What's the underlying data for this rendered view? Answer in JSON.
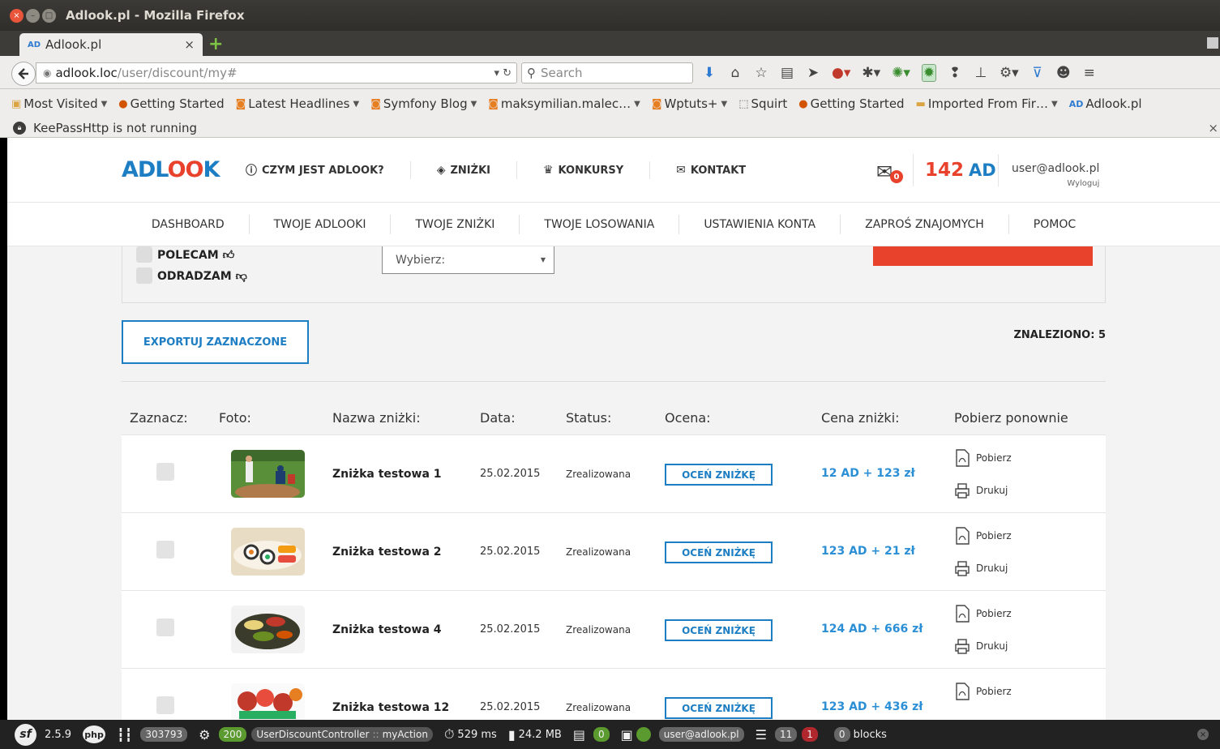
{
  "window": {
    "title": "Adlook.pl - Mozilla Firefox"
  },
  "tab": {
    "favicon": "AD",
    "title": "Adlook.pl",
    "close": "×",
    "new_tab": "+"
  },
  "navbar": {
    "url_host": "adlook.loc",
    "url_path": "/user/discount/my#",
    "search_placeholder": "Search",
    "toolbar_icons": [
      "download-icon",
      "home-icon",
      "star-icon",
      "reading-list-icon",
      "send-icon",
      "adblock-icon",
      "spy-icon",
      "bug-icon",
      "firebug-icon",
      "footprints-icon",
      "sitemap-icon",
      "gear-icon",
      "filter-icon",
      "chat-icon",
      "menu-icon"
    ]
  },
  "bookmarks": [
    {
      "label": "Most Visited",
      "icon": "folder-icon",
      "dropdown": true
    },
    {
      "label": "Getting Started",
      "icon": "firefox-icon",
      "dropdown": false
    },
    {
      "label": "Latest Headlines",
      "icon": "rss-icon",
      "dropdown": true
    },
    {
      "label": "Symfony Blog",
      "icon": "rss-icon",
      "dropdown": true
    },
    {
      "label": "maksymilian.malec…",
      "icon": "rss-icon",
      "dropdown": true
    },
    {
      "label": "Wptuts+",
      "icon": "rss-icon",
      "dropdown": true
    },
    {
      "label": "Squirt",
      "icon": "bookmark-icon",
      "dropdown": false
    },
    {
      "label": "Getting Started",
      "icon": "firefox-icon",
      "dropdown": false
    },
    {
      "label": "Imported From Fir…",
      "icon": "folder-icon",
      "dropdown": true
    },
    {
      "label": "Adlook.pl",
      "icon": "adlook-icon",
      "dropdown": false
    }
  ],
  "infobar": {
    "text": "KeePassHttp is not running"
  },
  "site": {
    "logo_a": "ADL",
    "logo_b": "OO",
    "logo_c": "K",
    "nav": [
      {
        "label": "CZYM JEST ADLOOK?",
        "icon": "info-icon"
      },
      {
        "label": "ZNIŻKI",
        "icon": "tag-icon"
      },
      {
        "label": "KONKURSY",
        "icon": "trophy-icon"
      },
      {
        "label": "KONTAKT",
        "icon": "envelope-icon"
      }
    ],
    "mail_count": "0",
    "ad_balance": "142",
    "ad_unit": "AD",
    "user_email": "user@adlook.pl",
    "logout": "Wyloguj",
    "subnav": [
      "DASHBOARD",
      "TWOJE ADLOOKI",
      "TWOJE ZNIŻKI",
      "TWOJE LOSOWANIA",
      "USTAWIENIA KONTA",
      "ZAPROŚ ZNAJOMYCH",
      "POMOC"
    ]
  },
  "filters": {
    "polecam": "POLECAM",
    "odradzam": "ODRADZAM",
    "select_value": "Wybierz:"
  },
  "actions": {
    "export": "EXPORTUJ ZAZNACZONE",
    "found": "ZNALEZIONO: 5"
  },
  "table": {
    "headers": [
      "Zaznacz:",
      "Foto:",
      "Nazwa zniżki:",
      "Data:",
      "Status:",
      "Ocena:",
      "Cena zniżki:",
      "Pobierz ponownie"
    ],
    "rate_label": "OCEŃ ZNIŻKĘ",
    "download_label": "Pobierz",
    "print_label": "Drukuj",
    "rows": [
      {
        "name": "Zniżka testowa 1",
        "date": "25.02.2015",
        "status": "Zrealizowana",
        "price": "12 AD + 123 zł",
        "photo": "baseball"
      },
      {
        "name": "Zniżka testowa 2",
        "date": "25.02.2015",
        "status": "Zrealizowana",
        "price": "123 AD + 21 zł",
        "photo": "sushi"
      },
      {
        "name": "Zniżka testowa 4",
        "date": "25.02.2015",
        "status": "Zrealizowana",
        "price": "124 AD + 666 zł",
        "photo": "grilled-vegetables"
      },
      {
        "name": "Zniżka testowa 12",
        "date": "25.02.2015",
        "status": "Zrealizowana",
        "price": "123 AD + 436 zł",
        "photo": "vegetables"
      }
    ]
  },
  "symfony_toolbar": {
    "version": "2.5.9",
    "php": "php",
    "token": "303793",
    "status_code": "200",
    "controller": "UserDiscountController",
    "action": "myAction",
    "time": "529 ms",
    "memory": "24.2 MB",
    "logs": "0",
    "user": "user@adlook.pl",
    "queries": "11",
    "errors": "1",
    "blocks_count": "0",
    "blocks_label": "blocks"
  },
  "colors": {
    "brand_blue": "#1d7ec3",
    "brand_red": "#e8412c",
    "price_blue": "#2b8fd6"
  }
}
